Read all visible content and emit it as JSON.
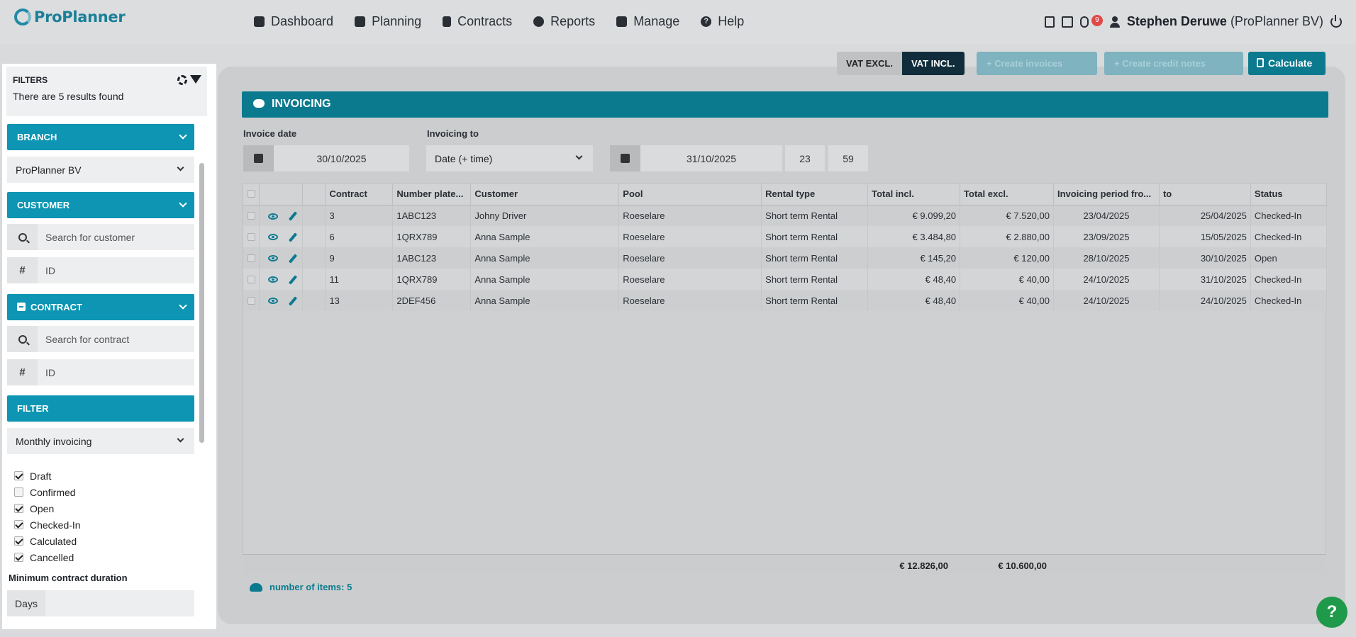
{
  "app": {
    "logo": "ProPlanner"
  },
  "nav": [
    {
      "label": "Dashboard",
      "icon": "grid-icon"
    },
    {
      "label": "Planning",
      "icon": "calendar-icon"
    },
    {
      "label": "Contracts",
      "icon": "document-icon"
    },
    {
      "label": "Reports",
      "icon": "pie-chart-icon"
    },
    {
      "label": "Manage",
      "icon": "list-icon"
    },
    {
      "label": "Help",
      "icon": "help-icon"
    }
  ],
  "user": {
    "name": "Stephen Deruwe",
    "company": "(ProPlanner BV)",
    "badge_count": "9"
  },
  "filters": {
    "title": "FILTERS",
    "results": "There are 5 results found",
    "branch_header": "BRANCH",
    "branch_value": "ProPlanner BV",
    "customer_header": "CUSTOMER",
    "customer_search_placeholder": "Search for customer",
    "customer_id_placeholder": "ID",
    "contract_header": "CONTRACT",
    "contract_search_placeholder": "Search for contract",
    "contract_id_placeholder": "ID",
    "filter_header": "FILTER",
    "filter_value": "Monthly invoicing",
    "statuses": [
      {
        "label": "Draft",
        "checked": true
      },
      {
        "label": "Confirmed",
        "checked": false
      },
      {
        "label": "Open",
        "checked": true
      },
      {
        "label": "Checked-In",
        "checked": true
      },
      {
        "label": "Calculated",
        "checked": true
      },
      {
        "label": "Cancelled",
        "checked": true
      }
    ],
    "min_duration_label": "Minimum contract duration",
    "days_label": "Days",
    "hash": "#"
  },
  "toolbar": {
    "vat_excl": "VAT EXCL.",
    "vat_incl": "VAT INCL.",
    "create_invoices": "+ Create invoices",
    "create_credit_notes": "+ Create credit notes",
    "calculate": "Calculate"
  },
  "invoicing": {
    "title": "INVOICING",
    "invoice_date_label": "Invoice date",
    "invoice_date": "30/10/2025",
    "invoicing_to_label": "Invoicing to",
    "invoicing_to_value": "Date (+ time)",
    "to_date": "31/10/2025",
    "hour": "23",
    "minute": "59"
  },
  "table": {
    "columns": [
      "Contract",
      "Number plate...",
      "Customer",
      "Pool",
      "Rental type",
      "Total incl.",
      "Total excl.",
      "Invoicing period fro...",
      "to",
      "Status"
    ],
    "rows": [
      [
        "3",
        "1ABC123",
        "Johny Driver",
        "Roeselare",
        "Short term Rental",
        "€ 9.099,20",
        "€ 7.520,00",
        "23/04/2025",
        "25/04/2025",
        "Checked-In"
      ],
      [
        "6",
        "1QRX789",
        "Anna Sample",
        "Roeselare",
        "Short term Rental",
        "€ 3.484,80",
        "€ 2.880,00",
        "23/09/2025",
        "15/05/2025",
        "Checked-In"
      ],
      [
        "9",
        "1ABC123",
        "Anna Sample",
        "Roeselare",
        "Short term Rental",
        "€ 145,20",
        "€ 120,00",
        "28/10/2025",
        "30/10/2025",
        "Open"
      ],
      [
        "11",
        "1QRX789",
        "Anna Sample",
        "Roeselare",
        "Short term Rental",
        "€ 48,40",
        "€ 40,00",
        "24/10/2025",
        "31/10/2025",
        "Checked-In"
      ],
      [
        "13",
        "2DEF456",
        "Anna Sample",
        "Roeselare",
        "Short term Rental",
        "€ 48,40",
        "€ 40,00",
        "24/10/2025",
        "24/10/2025",
        "Checked-In"
      ]
    ],
    "total_incl": "€ 12.826,00",
    "total_excl": "€ 10.600,00",
    "items_count": "number of items: 5"
  },
  "help_fab": "?"
}
